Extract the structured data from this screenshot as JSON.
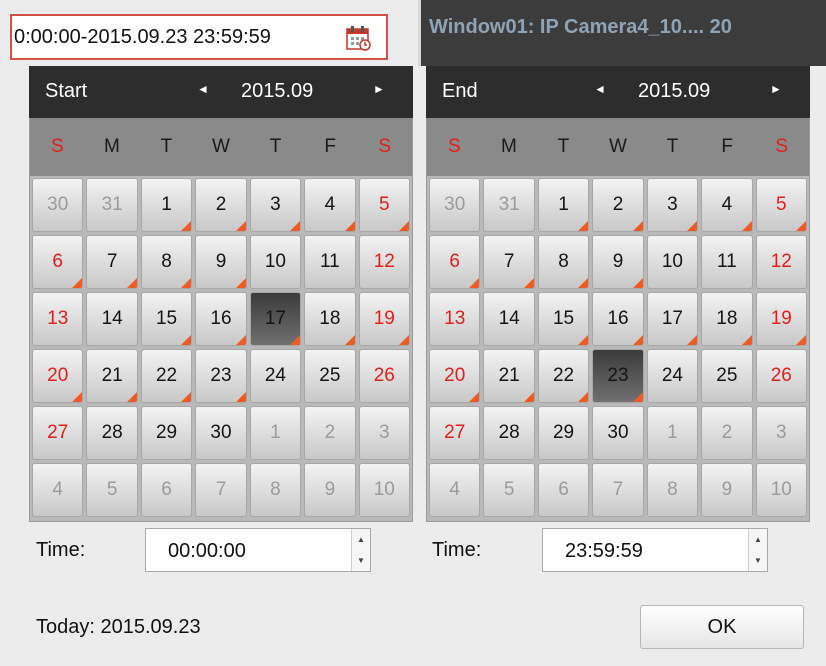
{
  "range_field": {
    "value": "0:00:00-2015.09.23 23:59:59"
  },
  "window": {
    "title": "Window01: IP Camera4_10.... 20"
  },
  "start_calendar": {
    "title": "Start",
    "month": "2015.09",
    "weekdays": [
      "S",
      "M",
      "T",
      "W",
      "T",
      "F",
      "S"
    ],
    "selected_day": "17",
    "days": [
      {
        "n": "30",
        "other": true,
        "rec": false
      },
      {
        "n": "31",
        "other": true,
        "rec": false
      },
      {
        "n": "1",
        "other": false,
        "rec": true
      },
      {
        "n": "2",
        "other": false,
        "rec": true
      },
      {
        "n": "3",
        "other": false,
        "rec": true
      },
      {
        "n": "4",
        "other": false,
        "rec": true
      },
      {
        "n": "5",
        "other": false,
        "rec": true
      },
      {
        "n": "6",
        "other": false,
        "rec": true
      },
      {
        "n": "7",
        "other": false,
        "rec": true
      },
      {
        "n": "8",
        "other": false,
        "rec": true
      },
      {
        "n": "9",
        "other": false,
        "rec": true
      },
      {
        "n": "10",
        "other": false,
        "rec": false
      },
      {
        "n": "11",
        "other": false,
        "rec": false
      },
      {
        "n": "12",
        "other": false,
        "rec": false
      },
      {
        "n": "13",
        "other": false,
        "rec": false
      },
      {
        "n": "14",
        "other": false,
        "rec": false
      },
      {
        "n": "15",
        "other": false,
        "rec": true
      },
      {
        "n": "16",
        "other": false,
        "rec": true
      },
      {
        "n": "17",
        "other": false,
        "rec": true
      },
      {
        "n": "18",
        "other": false,
        "rec": true
      },
      {
        "n": "19",
        "other": false,
        "rec": true
      },
      {
        "n": "20",
        "other": false,
        "rec": true
      },
      {
        "n": "21",
        "other": false,
        "rec": true
      },
      {
        "n": "22",
        "other": false,
        "rec": true
      },
      {
        "n": "23",
        "other": false,
        "rec": true
      },
      {
        "n": "24",
        "other": false,
        "rec": false
      },
      {
        "n": "25",
        "other": false,
        "rec": false
      },
      {
        "n": "26",
        "other": false,
        "rec": false
      },
      {
        "n": "27",
        "other": false,
        "rec": false
      },
      {
        "n": "28",
        "other": false,
        "rec": false
      },
      {
        "n": "29",
        "other": false,
        "rec": false
      },
      {
        "n": "30",
        "other": false,
        "rec": false
      },
      {
        "n": "1",
        "other": true,
        "rec": false
      },
      {
        "n": "2",
        "other": true,
        "rec": false
      },
      {
        "n": "3",
        "other": true,
        "rec": false
      },
      {
        "n": "4",
        "other": true,
        "rec": false
      },
      {
        "n": "5",
        "other": true,
        "rec": false
      },
      {
        "n": "6",
        "other": true,
        "rec": false
      },
      {
        "n": "7",
        "other": true,
        "rec": false
      },
      {
        "n": "8",
        "other": true,
        "rec": false
      },
      {
        "n": "9",
        "other": true,
        "rec": false
      },
      {
        "n": "10",
        "other": true,
        "rec": false
      }
    ]
  },
  "end_calendar": {
    "title": "End",
    "month": "2015.09",
    "weekdays": [
      "S",
      "M",
      "T",
      "W",
      "T",
      "F",
      "S"
    ],
    "selected_day": "23",
    "days": [
      {
        "n": "30",
        "other": true,
        "rec": false
      },
      {
        "n": "31",
        "other": true,
        "rec": false
      },
      {
        "n": "1",
        "other": false,
        "rec": true
      },
      {
        "n": "2",
        "other": false,
        "rec": true
      },
      {
        "n": "3",
        "other": false,
        "rec": true
      },
      {
        "n": "4",
        "other": false,
        "rec": true
      },
      {
        "n": "5",
        "other": false,
        "rec": true
      },
      {
        "n": "6",
        "other": false,
        "rec": true
      },
      {
        "n": "7",
        "other": false,
        "rec": true
      },
      {
        "n": "8",
        "other": false,
        "rec": true
      },
      {
        "n": "9",
        "other": false,
        "rec": true
      },
      {
        "n": "10",
        "other": false,
        "rec": false
      },
      {
        "n": "11",
        "other": false,
        "rec": false
      },
      {
        "n": "12",
        "other": false,
        "rec": false
      },
      {
        "n": "13",
        "other": false,
        "rec": false
      },
      {
        "n": "14",
        "other": false,
        "rec": false
      },
      {
        "n": "15",
        "other": false,
        "rec": true
      },
      {
        "n": "16",
        "other": false,
        "rec": true
      },
      {
        "n": "17",
        "other": false,
        "rec": true
      },
      {
        "n": "18",
        "other": false,
        "rec": true
      },
      {
        "n": "19",
        "other": false,
        "rec": true
      },
      {
        "n": "20",
        "other": false,
        "rec": true
      },
      {
        "n": "21",
        "other": false,
        "rec": true
      },
      {
        "n": "22",
        "other": false,
        "rec": true
      },
      {
        "n": "23",
        "other": false,
        "rec": true
      },
      {
        "n": "24",
        "other": false,
        "rec": false
      },
      {
        "n": "25",
        "other": false,
        "rec": false
      },
      {
        "n": "26",
        "other": false,
        "rec": false
      },
      {
        "n": "27",
        "other": false,
        "rec": false
      },
      {
        "n": "28",
        "other": false,
        "rec": false
      },
      {
        "n": "29",
        "other": false,
        "rec": false
      },
      {
        "n": "30",
        "other": false,
        "rec": false
      },
      {
        "n": "1",
        "other": true,
        "rec": false
      },
      {
        "n": "2",
        "other": true,
        "rec": false
      },
      {
        "n": "3",
        "other": true,
        "rec": false
      },
      {
        "n": "4",
        "other": true,
        "rec": false
      },
      {
        "n": "5",
        "other": true,
        "rec": false
      },
      {
        "n": "6",
        "other": true,
        "rec": false
      },
      {
        "n": "7",
        "other": true,
        "rec": false
      },
      {
        "n": "8",
        "other": true,
        "rec": false
      },
      {
        "n": "9",
        "other": true,
        "rec": false
      },
      {
        "n": "10",
        "other": true,
        "rec": false
      }
    ]
  },
  "start_time": {
    "label": "Time:",
    "value": "00:00:00"
  },
  "end_time": {
    "label": "Time:",
    "value": "23:59:59"
  },
  "footer": {
    "today": "Today: 2015.09.23",
    "ok_label": "OK"
  },
  "colors": {
    "weekend": "#e0201c",
    "record_marker": "#f05a24",
    "range_border": "#d5504a",
    "header_bg": "#2d2d2d"
  },
  "icons": {
    "calendar": "calendar-icon",
    "prev": "chevron-left-icon",
    "next": "chevron-right-icon"
  }
}
